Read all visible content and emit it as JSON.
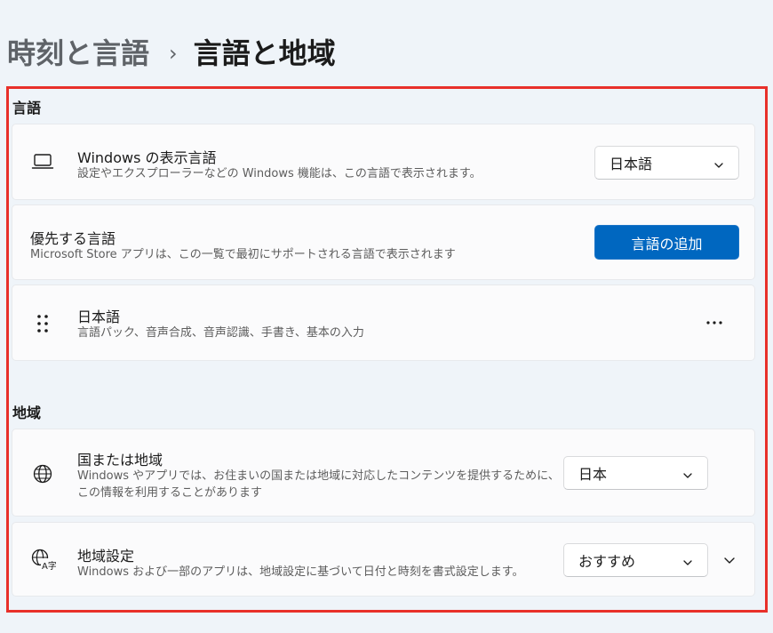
{
  "breadcrumb": {
    "parent": "時刻と言語",
    "separator": "›",
    "current": "言語と地域"
  },
  "language_section": {
    "title": "言語",
    "display_language": {
      "icon": "laptop-icon",
      "title": "Windows の表示言語",
      "description": "設定やエクスプローラーなどの Windows 機能は、この言語で表示されます。",
      "selected": "日本語"
    },
    "preferred_languages": {
      "title": "優先する言語",
      "description": "Microsoft Store アプリは、この一覧で最初にサポートされる言語で表示されます",
      "add_button": "言語の追加"
    },
    "languages": [
      {
        "icon": "drag-handle-icon",
        "name": "日本語",
        "features": "言語パック、音声合成、音声認識、手書き、基本の入力",
        "more_icon": "more-options-icon"
      }
    ]
  },
  "region_section": {
    "title": "地域",
    "country": {
      "icon": "globe-icon",
      "title": "国または地域",
      "description_line1": "Windows やアプリでは、お住まいの国または地域に対応したコンテンツを提供するために、",
      "description_line2": "この情報を利用することがあります",
      "selected": "日本"
    },
    "regional_format": {
      "icon": "regional-format-icon",
      "title": "地域設定",
      "description": "Windows および一部のアプリは、地域設定に基づいて日付と時刻を書式設定します。",
      "selected": "おすすめ"
    }
  },
  "colors": {
    "accent": "#0067c0",
    "highlight_border": "#e8302a",
    "background": "#eff4f9",
    "card": "#fbfbfc"
  }
}
